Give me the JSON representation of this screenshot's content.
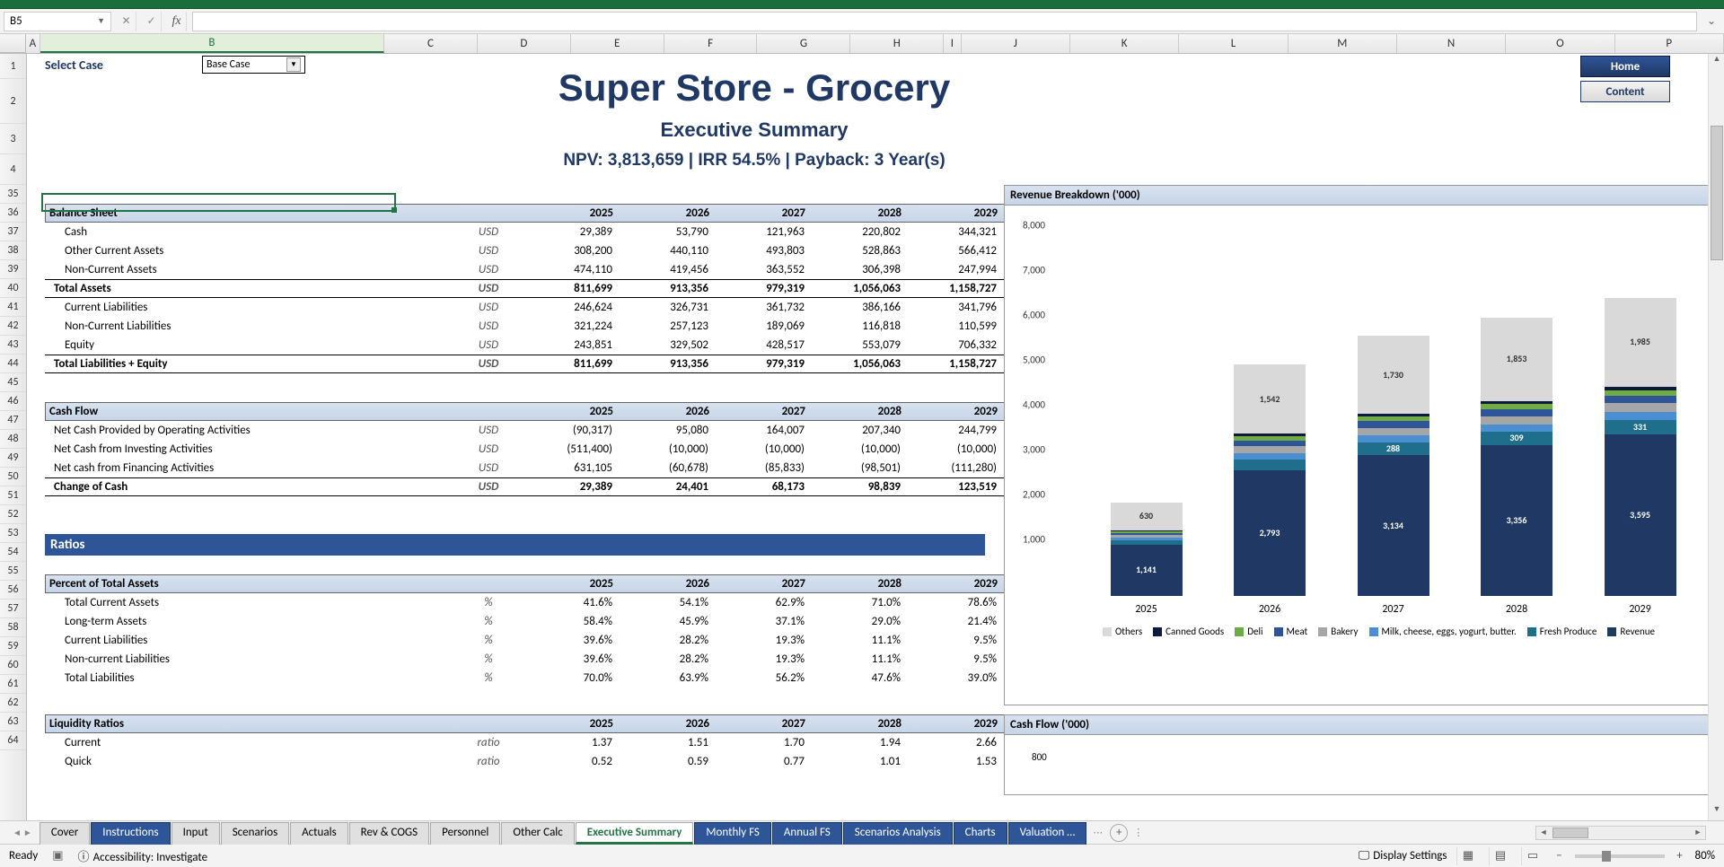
{
  "name_box": "B5",
  "select_case_label": "Select Case",
  "case_value": "Base Case",
  "title": "Super Store - Grocery",
  "subtitle": "Executive Summary",
  "metrics": "NPV: 3,813,659 | IRR 54.5% | Payback: 3 Year(s)",
  "nav": {
    "home": "Home",
    "content": "Content"
  },
  "row_headers_top": [
    "1",
    "2",
    "3",
    "4"
  ],
  "row_headers": [
    "35",
    "36",
    "37",
    "38",
    "39",
    "40",
    "41",
    "42",
    "43",
    "44",
    "45",
    "46",
    "47",
    "48",
    "49",
    "50",
    "51",
    "52",
    "53",
    "54",
    "55",
    "56",
    "57",
    "58",
    "59",
    "60",
    "61",
    "62",
    "63",
    "64"
  ],
  "col_headers": [
    "A",
    "B",
    "C",
    "D",
    "E",
    "F",
    "G",
    "H",
    "I",
    "J",
    "K",
    "L",
    "M",
    "N",
    "O",
    "P"
  ],
  "balance_sheet": {
    "header": "Balance Sheet",
    "years": [
      "2025",
      "2026",
      "2027",
      "2028",
      "2029"
    ],
    "rows": [
      {
        "label": "Cash",
        "unit": "USD",
        "vals": [
          "29,389",
          "53,790",
          "121,963",
          "220,802",
          "344,321"
        ],
        "indent": true
      },
      {
        "label": "Other Current Assets",
        "unit": "USD",
        "vals": [
          "308,200",
          "440,110",
          "493,803",
          "528,863",
          "566,412"
        ],
        "indent": true
      },
      {
        "label": "Non-Current Assets",
        "unit": "USD",
        "vals": [
          "474,110",
          "419,456",
          "363,552",
          "306,398",
          "247,994"
        ],
        "indent": true
      },
      {
        "label": "Total Assets",
        "unit": "USD",
        "vals": [
          "811,699",
          "913,356",
          "979,319",
          "1,056,063",
          "1,158,727"
        ],
        "bold": true,
        "bt": true,
        "bb": true
      },
      {
        "label": "Current Liabilities",
        "unit": "USD",
        "vals": [
          "246,624",
          "326,731",
          "361,732",
          "386,166",
          "341,796"
        ],
        "indent": true
      },
      {
        "label": "Non-Current Liabilities",
        "unit": "USD",
        "vals": [
          "321,224",
          "257,123",
          "189,069",
          "116,818",
          "110,599"
        ],
        "indent": true
      },
      {
        "label": "Equity",
        "unit": "USD",
        "vals": [
          "243,851",
          "329,502",
          "428,517",
          "553,079",
          "706,332"
        ],
        "indent": true
      },
      {
        "label": "Total Liabilities + Equity",
        "unit": "USD",
        "vals": [
          "811,699",
          "913,356",
          "979,319",
          "1,056,063",
          "1,158,727"
        ],
        "bold": true,
        "bt": true,
        "bb": true
      }
    ]
  },
  "cash_flow": {
    "header": "Cash Flow",
    "years": [
      "2025",
      "2026",
      "2027",
      "2028",
      "2029"
    ],
    "rows": [
      {
        "label": "Net Cash Provided by Operating Activities",
        "unit": "USD",
        "vals": [
          "(90,317)",
          "95,080",
          "164,007",
          "207,340",
          "244,799"
        ]
      },
      {
        "label": "Net Cash from Investing Activities",
        "unit": "USD",
        "vals": [
          "(511,400)",
          "(10,000)",
          "(10,000)",
          "(10,000)",
          "(10,000)"
        ]
      },
      {
        "label": "Net cash from Financing Activities",
        "unit": "USD",
        "vals": [
          "631,105",
          "(60,678)",
          "(85,833)",
          "(98,501)",
          "(111,280)"
        ]
      },
      {
        "label": "Change of Cash",
        "unit": "USD",
        "vals": [
          "29,389",
          "24,401",
          "68,173",
          "98,839",
          "123,519"
        ],
        "bold": true,
        "bt": true,
        "bb": true
      }
    ]
  },
  "ratios_banner": "Ratios",
  "pct_assets": {
    "header": "Percent of Total Assets",
    "years": [
      "2025",
      "2026",
      "2027",
      "2028",
      "2029"
    ],
    "rows": [
      {
        "label": "Total Current Assets",
        "unit": "%",
        "vals": [
          "41.6%",
          "54.1%",
          "62.9%",
          "71.0%",
          "78.6%"
        ],
        "indent": true
      },
      {
        "label": "Long-term Assets",
        "unit": "%",
        "vals": [
          "58.4%",
          "45.9%",
          "37.1%",
          "29.0%",
          "21.4%"
        ],
        "indent": true
      },
      {
        "label": "Current Liabilities",
        "unit": "%",
        "vals": [
          "39.6%",
          "28.2%",
          "19.3%",
          "11.1%",
          "9.5%"
        ],
        "indent": true
      },
      {
        "label": "Non-current Liabilities",
        "unit": "%",
        "vals": [
          "39.6%",
          "28.2%",
          "19.3%",
          "11.1%",
          "9.5%"
        ],
        "indent": true
      },
      {
        "label": "Total Liabilities",
        "unit": "%",
        "vals": [
          "70.0%",
          "63.9%",
          "56.2%",
          "47.6%",
          "39.0%"
        ],
        "indent": true
      }
    ]
  },
  "liquidity": {
    "header": "Liquidity Ratios",
    "years": [
      "2025",
      "2026",
      "2027",
      "2028",
      "2029"
    ],
    "rows": [
      {
        "label": "Current",
        "unit": "ratio",
        "vals": [
          "1.37",
          "1.51",
          "1.70",
          "1.94",
          "2.66"
        ],
        "indent": true
      },
      {
        "label": "Quick",
        "unit": "ratio",
        "vals": [
          "0.52",
          "0.59",
          "0.77",
          "1.01",
          "1.53"
        ],
        "indent": true
      }
    ]
  },
  "chart_data": {
    "type": "bar",
    "title": "Revenue Breakdown ('000)",
    "categories": [
      "2025",
      "2026",
      "2027",
      "2028",
      "2029"
    ],
    "ylim": [
      0,
      8000
    ],
    "yticks": [
      1000,
      2000,
      3000,
      4000,
      5000,
      6000,
      7000,
      8000
    ],
    "series": [
      {
        "name": "Revenue",
        "color": "#1f3864",
        "values": [
          1141,
          2793,
          3134,
          3356,
          3595
        ]
      },
      {
        "name": "Fresh Produce",
        "color": "#1f6e8c",
        "values": [
          105,
          257,
          288,
          309,
          331
        ]
      },
      {
        "name": "Milk, cheese, eggs, yogurt, butter.",
        "color": "#4a8fd1",
        "values": [
          56,
          137,
          154,
          165,
          176
        ]
      },
      {
        "name": "Bakery",
        "color": "#a6a6a6",
        "values": [
          55,
          150,
          168,
          180,
          193
        ]
      },
      {
        "name": "Meat",
        "color": "#2e5597",
        "values": [
          48,
          131,
          147,
          157,
          169
        ]
      },
      {
        "name": "Deli",
        "color": "#6fac46",
        "values": [
          35,
          96,
          108,
          115,
          124
        ]
      },
      {
        "name": "Canned Goods",
        "color": "#0d1a3a",
        "values": [
          20,
          55,
          62,
          66,
          71
        ]
      },
      {
        "name": "Others",
        "color": "#d9d9d9",
        "values": [
          630,
          1542,
          1730,
          1853,
          1985
        ]
      }
    ],
    "totals_top_labels": [
      "630",
      "1,542",
      "1,730",
      "1,853",
      "1,985"
    ]
  },
  "cashflow_chart": {
    "title": "Cash Flow ('000)",
    "first_tick": "800"
  },
  "tabs": [
    {
      "label": "Cover",
      "style": "plain"
    },
    {
      "label": "Instructions",
      "style": "blue"
    },
    {
      "label": "Input",
      "style": "plain"
    },
    {
      "label": "Scenarios",
      "style": "plain"
    },
    {
      "label": "Actuals",
      "style": "plain"
    },
    {
      "label": "Rev & COGS",
      "style": "plain"
    },
    {
      "label": "Personnel",
      "style": "plain"
    },
    {
      "label": "Other Calc",
      "style": "plain"
    },
    {
      "label": "Executive Summary",
      "style": "active"
    },
    {
      "label": "Monthly FS",
      "style": "blue"
    },
    {
      "label": "Annual FS",
      "style": "blue"
    },
    {
      "label": "Scenarios Analysis",
      "style": "blue"
    },
    {
      "label": "Charts",
      "style": "blue"
    },
    {
      "label": "Valuation",
      "style": "blue",
      "ell": true
    }
  ],
  "status": {
    "ready": "Ready",
    "accessibility": "Accessibility: Investigate",
    "display": "Display Settings",
    "zoom": "80%"
  }
}
